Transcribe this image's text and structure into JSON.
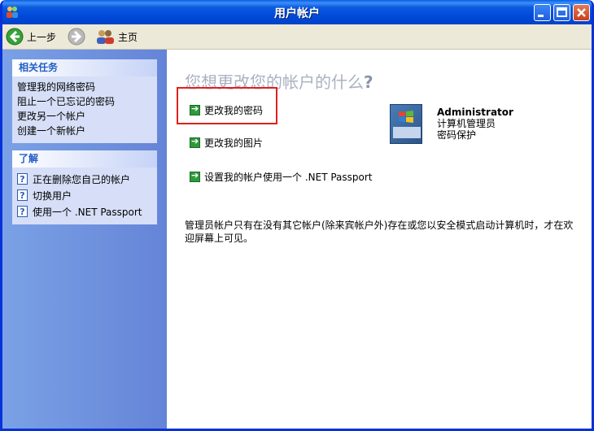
{
  "window": {
    "title": "用户帐户"
  },
  "toolbar": {
    "back_label": "上一步",
    "home_label": "主页"
  },
  "sidebar": {
    "related_tasks": {
      "title": "相关任务",
      "items": [
        "管理我的网络密码",
        "阻止一个已忘记的密码",
        "更改另一个帐户",
        "创建一个新帐户"
      ]
    },
    "learn": {
      "title": "了解",
      "items": [
        "正在删除您自己的帐户",
        "切换用户",
        "使用一个 .NET Passport"
      ]
    }
  },
  "main": {
    "heading": "您想更改您的帐户的什么",
    "heading_q": "?",
    "tasks": [
      "更改我的密码",
      "更改我的图片",
      "设置我的帐户使用一个 .NET Passport"
    ],
    "user": {
      "name": "Administrator",
      "role": "计算机管理员",
      "status": "密码保护"
    },
    "note": "管理员帐户只有在没有其它帐户(除来宾帐户外)存在或您以安全模式启动计算机时，才在欢迎屏幕上可见。"
  },
  "colors": {
    "highlight": "#e02020",
    "accent": "#215dc6"
  }
}
